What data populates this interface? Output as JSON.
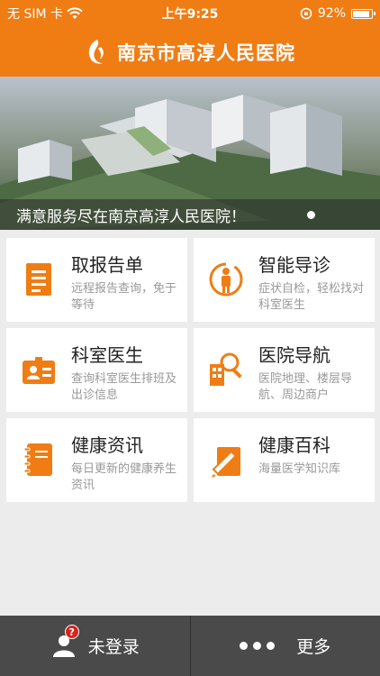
{
  "status_bar": {
    "carrier": "无 SIM 卡",
    "time": "上午9:25",
    "battery": "92%",
    "battery_level": 0.92
  },
  "header": {
    "title": "南京市高淳人民医院"
  },
  "banner": {
    "caption": "满意服务尽在南京高淳人民医院！"
  },
  "tiles": [
    {
      "title": "取报告单",
      "desc": "远程报告查询，免于等待",
      "icon": "report-icon"
    },
    {
      "title": "智能导诊",
      "desc": "症状自检，轻松找对科室医生",
      "icon": "body-check-icon"
    },
    {
      "title": "科室医生",
      "desc": "查询科室医生排班及出诊信息",
      "icon": "doctor-badge-icon"
    },
    {
      "title": "医院导航",
      "desc": "医院地理、楼层导航、周边商户",
      "icon": "building-search-icon"
    },
    {
      "title": "健康资讯",
      "desc": "每日更新的健康养生资讯",
      "icon": "notebook-icon"
    },
    {
      "title": "健康百科",
      "desc": "海量医学知识库",
      "icon": "pencil-doc-icon"
    }
  ],
  "footer": {
    "login_label": "未登录",
    "login_badge": "?",
    "more_label": "更多"
  },
  "colors": {
    "accent": "#ef7d14",
    "footer_bg": "#4a4a4a"
  }
}
